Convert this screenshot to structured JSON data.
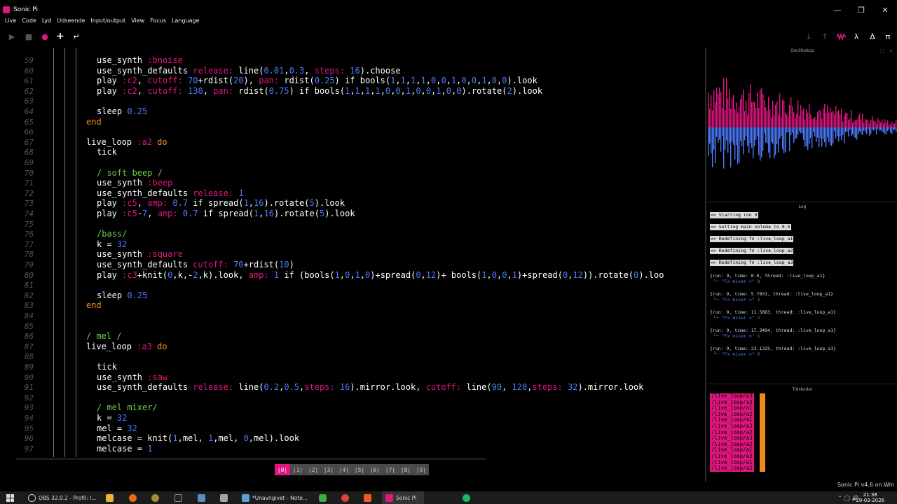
{
  "window": {
    "title": "Sonic Pi"
  },
  "menu": [
    "Live",
    "Code",
    "Lyd",
    "Udseende",
    "Input/output",
    "View",
    "Focus",
    "Language"
  ],
  "toolbar": {
    "right_icons": [
      "↓",
      "↑",
      "wave",
      "λ",
      "Δ",
      "π"
    ]
  },
  "editor": {
    "lines": [
      {
        "n": "59",
        "indent": 2,
        "t": [
          [
            "def",
            "use_synth "
          ],
          [
            "sym",
            ":bnoise"
          ]
        ]
      },
      {
        "n": "60",
        "indent": 2,
        "t": [
          [
            "def",
            "use_synth_defaults "
          ],
          [
            "key",
            "release: "
          ],
          [
            "def",
            "line("
          ],
          [
            "num",
            "0.01"
          ],
          [
            "def",
            ","
          ],
          [
            "num",
            "0.3"
          ],
          [
            "def",
            ", "
          ],
          [
            "key",
            "steps: "
          ],
          [
            "num",
            "16"
          ],
          [
            "def",
            ").choose"
          ]
        ]
      },
      {
        "n": "61",
        "indent": 2,
        "t": [
          [
            "def",
            "play "
          ],
          [
            "sym",
            ":c2"
          ],
          [
            "def",
            ", "
          ],
          [
            "key",
            "cutoff: "
          ],
          [
            "num",
            "70"
          ],
          [
            "def",
            "+rdist("
          ],
          [
            "num",
            "20"
          ],
          [
            "def",
            "), "
          ],
          [
            "key",
            "pan: "
          ],
          [
            "def",
            "rdist("
          ],
          [
            "num",
            "0.25"
          ],
          [
            "def",
            ") if bools("
          ],
          [
            "num",
            "1"
          ],
          [
            "def",
            ","
          ],
          [
            "num",
            "1"
          ],
          [
            "def",
            ","
          ],
          [
            "num",
            "1"
          ],
          [
            "def",
            ","
          ],
          [
            "num",
            "1"
          ],
          [
            "def",
            ","
          ],
          [
            "num",
            "0"
          ],
          [
            "def",
            ","
          ],
          [
            "num",
            "0"
          ],
          [
            "def",
            ","
          ],
          [
            "num",
            "1"
          ],
          [
            "def",
            ","
          ],
          [
            "num",
            "0"
          ],
          [
            "def",
            ","
          ],
          [
            "num",
            "0"
          ],
          [
            "def",
            ","
          ],
          [
            "num",
            "1"
          ],
          [
            "def",
            ","
          ],
          [
            "num",
            "0"
          ],
          [
            "def",
            ","
          ],
          [
            "num",
            "0"
          ],
          [
            "def",
            ").look"
          ]
        ]
      },
      {
        "n": "62",
        "indent": 2,
        "t": [
          [
            "def",
            "play "
          ],
          [
            "sym",
            ":c2"
          ],
          [
            "def",
            ", "
          ],
          [
            "key",
            "cutoff: "
          ],
          [
            "num",
            "130"
          ],
          [
            "def",
            ", "
          ],
          [
            "key",
            "pan: "
          ],
          [
            "def",
            "rdist("
          ],
          [
            "num",
            "0.75"
          ],
          [
            "def",
            ") if bools("
          ],
          [
            "num",
            "1"
          ],
          [
            "def",
            ","
          ],
          [
            "num",
            "1"
          ],
          [
            "def",
            ","
          ],
          [
            "num",
            "1"
          ],
          [
            "def",
            ","
          ],
          [
            "num",
            "1"
          ],
          [
            "def",
            ","
          ],
          [
            "num",
            "0"
          ],
          [
            "def",
            ","
          ],
          [
            "num",
            "0"
          ],
          [
            "def",
            ","
          ],
          [
            "num",
            "1"
          ],
          [
            "def",
            ","
          ],
          [
            "num",
            "0"
          ],
          [
            "def",
            ","
          ],
          [
            "num",
            "0"
          ],
          [
            "def",
            ","
          ],
          [
            "num",
            "1"
          ],
          [
            "def",
            ","
          ],
          [
            "num",
            "0"
          ],
          [
            "def",
            ","
          ],
          [
            "num",
            "0"
          ],
          [
            "def",
            ").rotate("
          ],
          [
            "num",
            "2"
          ],
          [
            "def",
            ").look"
          ]
        ]
      },
      {
        "n": "63",
        "indent": 2,
        "t": []
      },
      {
        "n": "64",
        "indent": 2,
        "t": [
          [
            "def",
            "sleep "
          ],
          [
            "num",
            "0.25"
          ]
        ]
      },
      {
        "n": "65",
        "indent": 1,
        "t": [
          [
            "kw",
            "end"
          ]
        ]
      },
      {
        "n": "66",
        "indent": 1,
        "t": []
      },
      {
        "n": "67",
        "indent": 1,
        "t": [
          [
            "def",
            "live_loop "
          ],
          [
            "sym",
            ":a2"
          ],
          [
            "def",
            " "
          ],
          [
            "kw",
            "do"
          ]
        ]
      },
      {
        "n": "68",
        "indent": 2,
        "t": [
          [
            "def",
            "tick"
          ]
        ]
      },
      {
        "n": "69",
        "indent": 2,
        "t": []
      },
      {
        "n": "70",
        "indent": 2,
        "t": [
          [
            "cmt",
            "/ soft beep /"
          ]
        ]
      },
      {
        "n": "71",
        "indent": 2,
        "t": [
          [
            "def",
            "use_synth "
          ],
          [
            "sym",
            ":beep"
          ]
        ]
      },
      {
        "n": "72",
        "indent": 2,
        "t": [
          [
            "def",
            "use_synth_defaults "
          ],
          [
            "key",
            "release: "
          ],
          [
            "num",
            "1"
          ]
        ]
      },
      {
        "n": "73",
        "indent": 2,
        "t": [
          [
            "def",
            "play "
          ],
          [
            "sym",
            ":c5"
          ],
          [
            "def",
            ", "
          ],
          [
            "key",
            "amp: "
          ],
          [
            "num",
            "0.7"
          ],
          [
            "def",
            " if spread("
          ],
          [
            "num",
            "1"
          ],
          [
            "def",
            ","
          ],
          [
            "num",
            "16"
          ],
          [
            "def",
            ").rotate("
          ],
          [
            "num",
            "5"
          ],
          [
            "def",
            ").look"
          ]
        ]
      },
      {
        "n": "74",
        "indent": 2,
        "t": [
          [
            "def",
            "play "
          ],
          [
            "sym",
            ":c5"
          ],
          [
            "def",
            "-"
          ],
          [
            "num",
            "7"
          ],
          [
            "def",
            ", "
          ],
          [
            "key",
            "amp: "
          ],
          [
            "num",
            "0.7"
          ],
          [
            "def",
            " if spread("
          ],
          [
            "num",
            "1"
          ],
          [
            "def",
            ","
          ],
          [
            "num",
            "16"
          ],
          [
            "def",
            ").rotate("
          ],
          [
            "num",
            "5"
          ],
          [
            "def",
            ").look"
          ]
        ]
      },
      {
        "n": "75",
        "indent": 2,
        "t": []
      },
      {
        "n": "76",
        "indent": 2,
        "t": [
          [
            "cmt",
            "/bass/"
          ]
        ]
      },
      {
        "n": "77",
        "indent": 2,
        "t": [
          [
            "def",
            "k = "
          ],
          [
            "num",
            "32"
          ]
        ]
      },
      {
        "n": "78",
        "indent": 2,
        "t": [
          [
            "def",
            "use_synth "
          ],
          [
            "sym",
            ":square"
          ]
        ]
      },
      {
        "n": "79",
        "indent": 2,
        "t": [
          [
            "def",
            "use_synth_defaults "
          ],
          [
            "key",
            "cutoff: "
          ],
          [
            "num",
            "70"
          ],
          [
            "def",
            "+rdist("
          ],
          [
            "num",
            "10"
          ],
          [
            "def",
            ")"
          ]
        ]
      },
      {
        "n": "80",
        "indent": 2,
        "t": [
          [
            "def",
            "play "
          ],
          [
            "sym",
            ":c3"
          ],
          [
            "def",
            "+knit("
          ],
          [
            "num",
            "0"
          ],
          [
            "def",
            ",k,-"
          ],
          [
            "num",
            "2"
          ],
          [
            "def",
            ",k).look, "
          ],
          [
            "key",
            "amp: "
          ],
          [
            "num",
            "1"
          ],
          [
            "def",
            " if (bools("
          ],
          [
            "num",
            "1"
          ],
          [
            "def",
            ","
          ],
          [
            "num",
            "0"
          ],
          [
            "def",
            ","
          ],
          [
            "num",
            "1"
          ],
          [
            "def",
            ","
          ],
          [
            "num",
            "0"
          ],
          [
            "def",
            ")+spread("
          ],
          [
            "num",
            "0"
          ],
          [
            "def",
            ","
          ],
          [
            "num",
            "12"
          ],
          [
            "def",
            ")+ bools("
          ],
          [
            "num",
            "1"
          ],
          [
            "def",
            ","
          ],
          [
            "num",
            "0"
          ],
          [
            "def",
            ","
          ],
          [
            "num",
            "0"
          ],
          [
            "def",
            ","
          ],
          [
            "num",
            "1"
          ],
          [
            "def",
            ")+spread("
          ],
          [
            "num",
            "0"
          ],
          [
            "def",
            ","
          ],
          [
            "num",
            "12"
          ],
          [
            "def",
            ")).rotate("
          ],
          [
            "num",
            "0"
          ],
          [
            "def",
            ").loo"
          ]
        ]
      },
      {
        "n": "81",
        "indent": 2,
        "t": []
      },
      {
        "n": "82",
        "indent": 2,
        "t": [
          [
            "def",
            "sleep "
          ],
          [
            "num",
            "0.25"
          ]
        ]
      },
      {
        "n": "83",
        "indent": 1,
        "t": [
          [
            "kw",
            "end"
          ]
        ]
      },
      {
        "n": "84",
        "indent": 1,
        "t": []
      },
      {
        "n": "85",
        "indent": 1,
        "t": []
      },
      {
        "n": "86",
        "indent": 1,
        "t": [
          [
            "cmt",
            "/ mel /"
          ]
        ]
      },
      {
        "n": "87",
        "indent": 1,
        "t": [
          [
            "def",
            "live_loop "
          ],
          [
            "sym",
            ":a3"
          ],
          [
            "def",
            " "
          ],
          [
            "kw",
            "do"
          ]
        ]
      },
      {
        "n": "88",
        "indent": 2,
        "t": []
      },
      {
        "n": "89",
        "indent": 2,
        "t": [
          [
            "def",
            "tick"
          ]
        ]
      },
      {
        "n": "90",
        "indent": 2,
        "t": [
          [
            "def",
            "use_synth "
          ],
          [
            "sym",
            ":saw"
          ]
        ]
      },
      {
        "n": "91",
        "indent": 2,
        "t": [
          [
            "def",
            "use_synth_defaults "
          ],
          [
            "key",
            "release: "
          ],
          [
            "def",
            "line("
          ],
          [
            "num",
            "0.2"
          ],
          [
            "def",
            ","
          ],
          [
            "num",
            "0.5"
          ],
          [
            "def",
            ","
          ],
          [
            "key",
            "steps: "
          ],
          [
            "num",
            "16"
          ],
          [
            "def",
            ").mirror.look, "
          ],
          [
            "key",
            "cutoff: "
          ],
          [
            "def",
            "line("
          ],
          [
            "num",
            "90"
          ],
          [
            "def",
            ", "
          ],
          [
            "num",
            "120"
          ],
          [
            "def",
            ","
          ],
          [
            "key",
            "steps: "
          ],
          [
            "num",
            "32"
          ],
          [
            "def",
            ").mirror.look"
          ]
        ]
      },
      {
        "n": "92",
        "indent": 2,
        "t": []
      },
      {
        "n": "93",
        "indent": 2,
        "t": [
          [
            "cmt",
            "/ mel mixer/"
          ]
        ]
      },
      {
        "n": "94",
        "indent": 2,
        "t": [
          [
            "def",
            "k = "
          ],
          [
            "num",
            "32"
          ]
        ]
      },
      {
        "n": "95",
        "indent": 2,
        "t": [
          [
            "def",
            "mel = "
          ],
          [
            "num",
            "32"
          ]
        ]
      },
      {
        "n": "96",
        "indent": 2,
        "t": [
          [
            "def",
            "melcase = knit("
          ],
          [
            "num",
            "1"
          ],
          [
            "def",
            ",mel, "
          ],
          [
            "num",
            "1"
          ],
          [
            "def",
            ",mel, "
          ],
          [
            "num",
            "0"
          ],
          [
            "def",
            ",mel).look"
          ]
        ]
      },
      {
        "n": "97",
        "indent": 2,
        "t": [
          [
            "def",
            "melcase = "
          ],
          [
            "num",
            "1"
          ]
        ]
      }
    ]
  },
  "tabs": [
    "|0|",
    "|1|",
    "|2|",
    "|3|",
    "|4|",
    "|5|",
    "|6|",
    "|7|",
    "|8|",
    "|9|"
  ],
  "active_tab": 0,
  "panels": {
    "scope_title": "Oscilloskop",
    "log_title": "Log",
    "cues_title": "Tidskoder"
  },
  "log": {
    "highlights": [
      "=> Starting run 9",
      "=> Setting main volume to 0.5",
      "=> Redefining fn :live_loop_a1",
      "=> Redefining fn :live_loop_a2",
      "=> Redefining fn :live_loop_a3"
    ],
    "entries": [
      {
        "head": "{run: 9, time: 0.0, thread: :live_loop_a1}",
        "sub": "└─ \"Fx mixer =\" 0"
      },
      {
        "head": "{run: 9, time: 5.7831, thread: :live_loop_a1}",
        "sub": "└─ \"Fx mixer =\" 1"
      },
      {
        "head": "{run: 9, time: 11.5663, thread: :live_loop_a1}",
        "sub": "└─ \"Fx mixer =\" 2"
      },
      {
        "head": "{run: 9, time: 17.3494, thread: :live_loop_a1}",
        "sub": "└─ \"Fx mixer =\" 1"
      },
      {
        "head": "{run: 9, time: 23.1325, thread: :live_loop_a1}",
        "sub": "└─ \"Fx mixer =\" 0"
      }
    ]
  },
  "cues": [
    "/live_loop/a3",
    "/live_loop/a3",
    "/live_loop/a1",
    "/live_loop/a2",
    "/live_loop/a1",
    "/live_loop/a3",
    "/live_loop/a2",
    "/live_loop/a3",
    "/live_loop/a2",
    "/live_loop/a1",
    "/live_loop/a3",
    "/live_loop/a1",
    "/live_loop/a2"
  ],
  "version": "Sonic Pi v4.6 on Win",
  "taskbar": {
    "obs": "OBS 32.0.2 - Profil: I...",
    "notepad": "*Unavngivet - Note...",
    "sonicpi": "Sonic Pi",
    "time": "21:38",
    "date": "29-03-2026"
  },
  "colors": {
    "accent": "#e0167f",
    "number": "#4d7cff",
    "comment": "#6ecf4a",
    "keyword": "#f2891d"
  }
}
